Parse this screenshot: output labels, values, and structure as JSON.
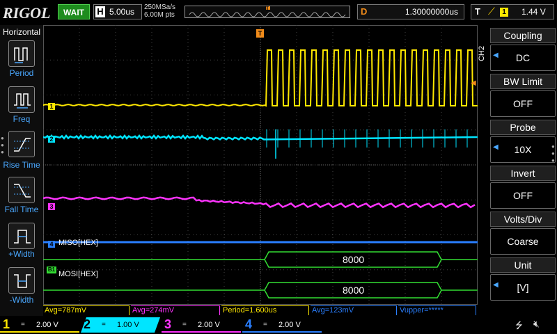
{
  "topbar": {
    "logo": "RIGOL",
    "run_status": "WAIT",
    "horizontal": {
      "label": "H",
      "value": "5.00us"
    },
    "sample_rate": "250MSa/s",
    "memory_depth": "6.00M pts",
    "trigger_marker": "T",
    "delay": {
      "label": "D",
      "value": "1.30000000us"
    },
    "trigger": {
      "label": "T",
      "edge": "rising-edge-icon",
      "source": "1",
      "level": "1.44 V"
    }
  },
  "left_menu": {
    "title": "Horizontal",
    "items": [
      {
        "label": "Period",
        "icon": "period-icon"
      },
      {
        "label": "Freq",
        "icon": "freq-icon"
      },
      {
        "label": "Rise Time",
        "icon": "rise-time-icon"
      },
      {
        "label": "Fall Time",
        "icon": "fall-time-icon"
      },
      {
        "label": "+Width",
        "icon": "pos-width-icon"
      },
      {
        "label": "-Width",
        "icon": "neg-width-icon"
      }
    ]
  },
  "right_menu": {
    "channel": "CH2",
    "groups": [
      {
        "title": "Coupling",
        "value": "DC",
        "arrow": true
      },
      {
        "title": "BW Limit",
        "value": "OFF",
        "arrow": false
      },
      {
        "title": "Probe",
        "value": "10X",
        "arrow": true
      },
      {
        "title": "Invert",
        "value": "OFF",
        "arrow": false
      },
      {
        "title": "Volts/Div",
        "value": "Coarse",
        "arrow": false
      },
      {
        "title": "Unit",
        "value": "[V]",
        "arrow": true
      }
    ]
  },
  "waveform": {
    "channel_markers": [
      "1",
      "2",
      "3",
      "4",
      "B1"
    ],
    "trigger_position_marker": "T",
    "bus1": {
      "label": "MISO[HEX]",
      "value": "8000"
    },
    "bus2": {
      "label": "MOSI[HEX]",
      "value": "8000"
    }
  },
  "measurements": [
    {
      "text": "Avg=787mV",
      "color": "#ffe800"
    },
    {
      "text": "Avg=274mV",
      "color": "#ff33ff"
    },
    {
      "text": "Period=1.600us",
      "color": "#ffe800"
    },
    {
      "text": "Avg=123mV",
      "color": "#2a7fff"
    },
    {
      "text": "Vupper=*****",
      "color": "#2a7fff"
    }
  ],
  "channels": [
    {
      "num": "1",
      "coupling": "=",
      "scale": "2.00 V",
      "color": "#ffe800",
      "active": false
    },
    {
      "num": "2",
      "coupling": "=",
      "scale": "1.00 V",
      "color": "#00e5ff",
      "active": true
    },
    {
      "num": "3",
      "coupling": "=",
      "scale": "2.00 V",
      "color": "#ff33ff",
      "active": false
    },
    {
      "num": "4",
      "coupling": "=",
      "scale": "2.00 V",
      "color": "#2a7fff",
      "active": false
    }
  ],
  "colors": {
    "ch1": "#ffe800",
    "ch2": "#00e5ff",
    "ch3": "#ff33ff",
    "ch4": "#2a7fff",
    "bus": "#33dd33",
    "trigger": "#f08b1a"
  }
}
